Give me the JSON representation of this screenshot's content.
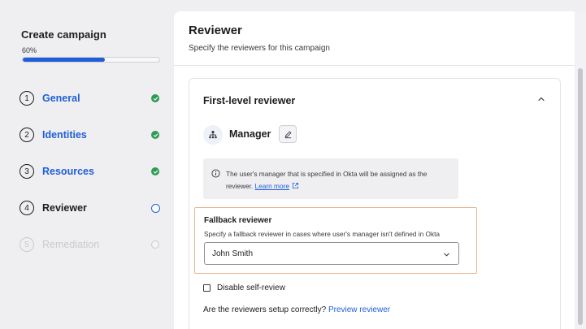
{
  "sidebar": {
    "title": "Create campaign",
    "progress_text": "60%",
    "progress_fraction": 0.6,
    "steps": [
      {
        "num": "1",
        "label": "General",
        "state": "done"
      },
      {
        "num": "2",
        "label": "Identities",
        "state": "done"
      },
      {
        "num": "3",
        "label": "Resources",
        "state": "done"
      },
      {
        "num": "4",
        "label": "Reviewer",
        "state": "current"
      },
      {
        "num": "5",
        "label": "Remediation",
        "state": "pending"
      }
    ]
  },
  "main": {
    "title": "Reviewer",
    "subtitle": "Specify the reviewers for this campaign",
    "card": {
      "title": "First-level reviewer",
      "reviewer_type": "Manager",
      "info_text": "The user's manager that is specified in Okta will be assigned as the reviewer.",
      "learn_more": "Learn more",
      "fallback": {
        "title": "Fallback reviewer",
        "subtitle": "Specify a fallback reviewer in cases where user's manager isn't defined in Okta",
        "selected": "John Smith"
      },
      "self_review_label": "Disable self-review",
      "preview_question": "Are the reviewers setup correctly?",
      "preview_link": "Preview reviewer"
    }
  },
  "icons": {
    "step_done": "check-circle-icon",
    "step_current": "ring-icon",
    "collapse": "chevron-up-icon",
    "manager": "org-chart-icon",
    "edit": "pencil-icon",
    "info": "info-icon",
    "external": "external-link-icon",
    "dropdown": "chevron-down-icon"
  },
  "colors": {
    "accent": "#1f5ed8",
    "success": "#2f9a55",
    "highlight_border": "#e8b48e"
  }
}
